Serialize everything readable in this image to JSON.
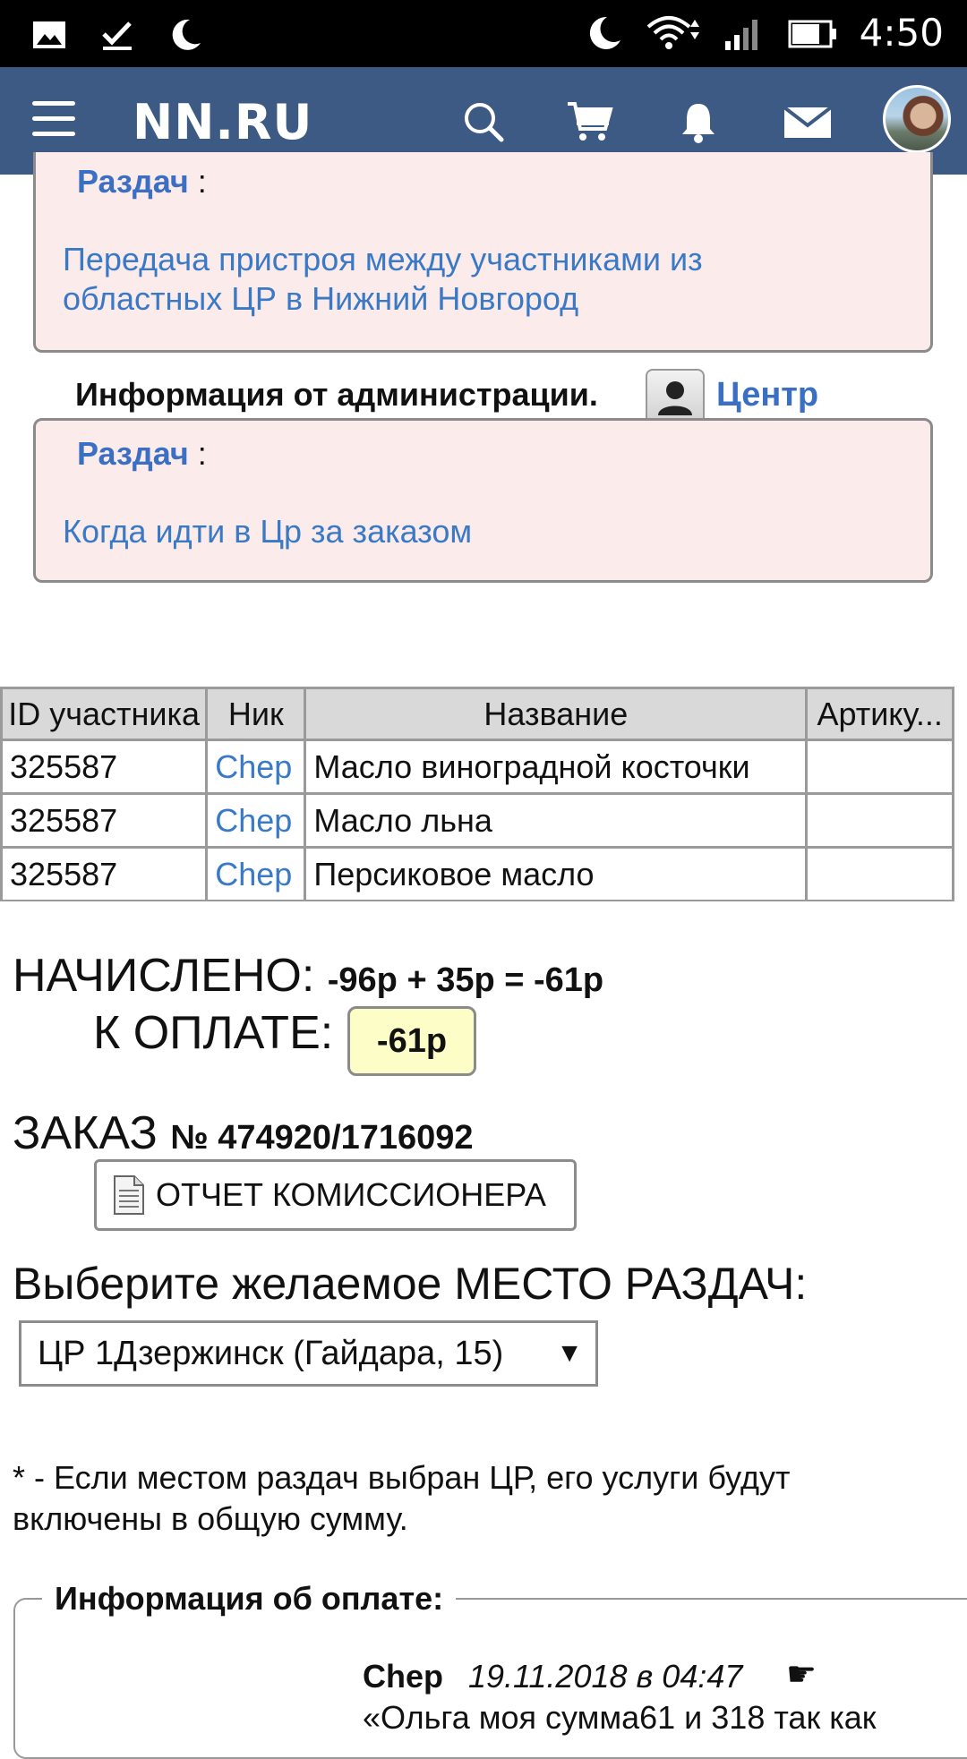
{
  "status_bar": {
    "time": "4:50",
    "left_icons": [
      "gallery-icon",
      "check-icon",
      "moon-icon"
    ],
    "right_icons": [
      "moon-icon",
      "wifi-icon",
      "signal-icon",
      "battery-icon"
    ]
  },
  "header": {
    "logo": "NN.RU",
    "icons": [
      "menu-icon",
      "search-icon",
      "cart-icon",
      "bell-icon",
      "mail-icon"
    ],
    "bg_color": "#3d5a85"
  },
  "box1": {
    "razdach_label": "Раздач",
    "colon": " :",
    "link_line1": "Передача пристроя между участниками из",
    "link_line2": "областных ЦР в Нижний Новгород"
  },
  "admin": {
    "title": "Информация от администрации.",
    "author": "Центр"
  },
  "box2": {
    "razdach_label": "Раздач",
    "colon": " :",
    "link": "Когда идти в Цр за заказом"
  },
  "table": {
    "headers": [
      "ID участника",
      "Ник",
      "Название",
      "Артику..."
    ],
    "rows": [
      {
        "id": "325587",
        "nick": "Chep",
        "name": "Масло виноградной косточки"
      },
      {
        "id": "325587",
        "nick": "Chep",
        "name": "Масло льна"
      },
      {
        "id": "325587",
        "nick": "Chep",
        "name": "Персиковое масло"
      }
    ]
  },
  "totals": {
    "charged_label": "НАЧИСЛЕНО:",
    "charged_value": "-96р + 35р = -61р",
    "pay_label": "К ОПЛАТЕ:",
    "pay_value": "-61р"
  },
  "order": {
    "label": "ЗАКАЗ",
    "number": "№ 474920/1716092",
    "report_button": "ОТЧЕТ КОМИССИОНЕРА"
  },
  "place": {
    "title": "Выберите желаемое МЕСТО РАЗДАЧ:",
    "selected": "ЦР 1Дзержинск (Гайдара, 15)",
    "note": "* - Если местом раздач выбран ЦР, его услуги будут включены в общую сумму."
  },
  "payment_info": {
    "legend": "Информация об оплате:",
    "author": "Chep",
    "date": "19.11.2018 в 04:47",
    "hand": "☛",
    "text": "«Ольга моя сумма61 и 318 так как"
  }
}
